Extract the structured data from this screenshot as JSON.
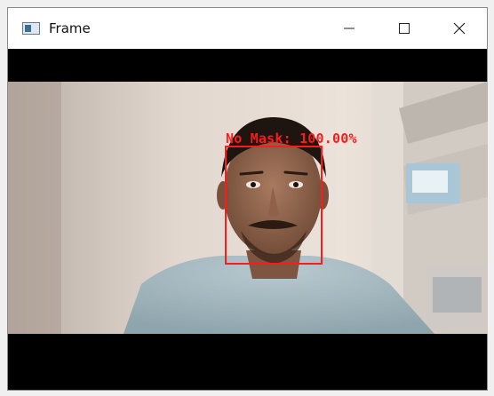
{
  "window": {
    "title": "Frame",
    "icons": {
      "app": "app-window-icon",
      "minimize": "minimize-icon",
      "maximize": "maximize-icon",
      "close": "close-icon"
    }
  },
  "detection": {
    "label": "No Mask: 100.00%",
    "box_color": "#ff1a1a"
  }
}
